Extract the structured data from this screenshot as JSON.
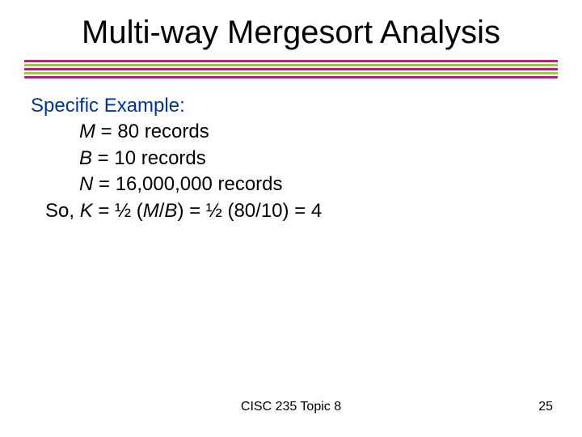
{
  "title": "Multi-way Mergesort Analysis",
  "heading": "Specific Example:",
  "lines": {
    "m_var": "M",
    "m_rest": " = 80 records",
    "b_var": "B",
    "b_rest": " = 10 records",
    "n_var": "N",
    "n_rest": " = 16,000,000 records",
    "so_prefix": "So, ",
    "k_var": "K",
    "so_mid": " = ½ (",
    "mb_m": "M",
    "mb_slash": "/",
    "mb_b": "B",
    "so_suffix": ") = ½ (80/10) = 4"
  },
  "footer": {
    "center": "CISC 235 Topic 8",
    "page": "25"
  },
  "colors": {
    "pink": "#c71585",
    "green": "#9acd32",
    "heading": "#003399"
  }
}
